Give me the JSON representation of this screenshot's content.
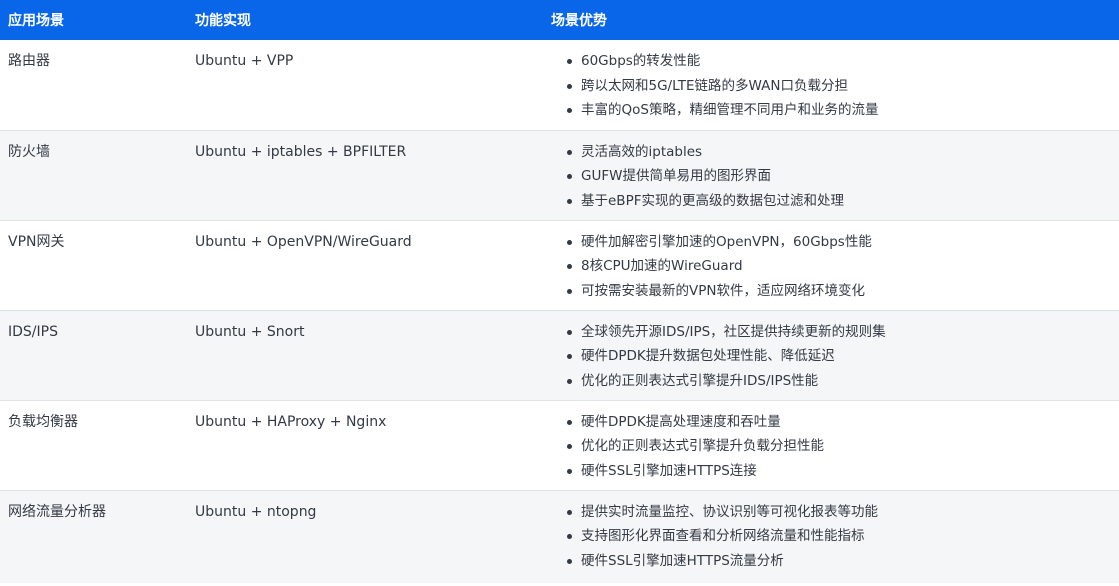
{
  "header": {
    "col1": "应用场景",
    "col2": "功能实现",
    "col3": "场景优势"
  },
  "rows": [
    {
      "scenario": "路由器",
      "implementation": "Ubuntu + VPP",
      "advantages": [
        "60Gbps的转发性能",
        "跨以太网和5G/LTE链路的多WAN口负载分担",
        "丰富的QoS策略，精细管理不同用户和业务的流量"
      ]
    },
    {
      "scenario": "防火墙",
      "implementation": "Ubuntu + iptables + BPFILTER",
      "advantages": [
        "灵活高效的iptables",
        "GUFW提供简单易用的图形界面",
        "基于eBPF实现的更高级的数据包过滤和处理"
      ]
    },
    {
      "scenario": "VPN网关",
      "implementation": "Ubuntu + OpenVPN/WireGuard",
      "advantages": [
        "硬件加解密引擎加速的OpenVPN，60Gbps性能",
        "8核CPU加速的WireGuard",
        "可按需安装最新的VPN软件，适应网络环境变化"
      ]
    },
    {
      "scenario": "IDS/IPS",
      "implementation": "Ubuntu + Snort",
      "advantages": [
        "全球领先开源IDS/IPS，社区提供持续更新的规则集",
        "硬件DPDK提升数据包处理性能、降低延迟",
        "优化的正则表达式引擎提升IDS/IPS性能"
      ]
    },
    {
      "scenario": "负载均衡器",
      "implementation": "Ubuntu + HAProxy + Nginx",
      "advantages": [
        "硬件DPDK提高处理速度和吞吐量",
        "优化的正则表达式引擎提升负载分担性能",
        "硬件SSL引擎加速HTTPS连接"
      ]
    },
    {
      "scenario": "网络流量分析器",
      "implementation": "Ubuntu + ntopng",
      "advantages": [
        "提供实时流量监控、协议识别等可视化报表等功能",
        "支持图形化界面查看和分析网络流量和性能指标",
        "硬件SSL引擎加速HTTPS流量分析"
      ]
    }
  ],
  "colors": {
    "header_bg": "#0a66e8",
    "header_text": "#ffffff",
    "body_text": "#333a45",
    "alt_row_bg": "#f5f6f7"
  }
}
